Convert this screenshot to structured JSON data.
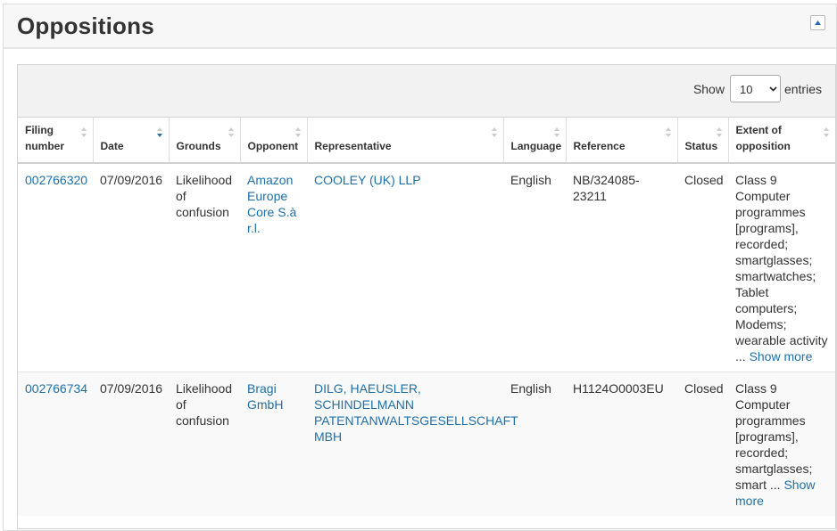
{
  "panel": {
    "title": "Oppositions"
  },
  "length": {
    "prefix": "Show",
    "value": "10",
    "suffix": "entries"
  },
  "columns": [
    {
      "label": "Filing number"
    },
    {
      "label": "Date"
    },
    {
      "label": "Grounds"
    },
    {
      "label": "Opponent"
    },
    {
      "label": "Representative"
    },
    {
      "label": "Language"
    },
    {
      "label": "Reference"
    },
    {
      "label": "Status"
    },
    {
      "label": "Extent of opposition"
    }
  ],
  "rows": [
    {
      "filing_number": "002766320",
      "date": "07/09/2016",
      "grounds": "Likelihood of confusion",
      "opponent": "Amazon Europe Core S.à r.l.",
      "representative": "COOLEY (UK) LLP",
      "language": "English",
      "reference": "NB/324085-23211",
      "status": "Closed",
      "extent": "Class 9 Computer programmes [programs], recorded; smartglasses; smartwatches; Tablet computers; Modems; wearable activity",
      "ellipsis": " ... ",
      "show_more": "Show more"
    },
    {
      "filing_number": "002766734",
      "date": "07/09/2016",
      "grounds": "Likelihood of confusion",
      "opponent": "Bragi GmbH",
      "representative": "DILG, HAEUSLER, SCHINDELMANN PATENTANWALTSGESELLSCHAFT MBH",
      "language": "English",
      "reference": "H1124O0003EU",
      "status": "Closed",
      "extent": "Class 9 Computer programmes [programs], recorded; smartglasses; smart",
      "ellipsis": " ... ",
      "show_more": "Show more"
    }
  ],
  "colors": {
    "link": "#1f6fa8",
    "header_bg": "#f7f7f7",
    "toolbar_bg": "#f2f2f2"
  },
  "icons": {
    "collapse": "caret-up-icon",
    "sort": "sort-both-icon",
    "sort_active": "sort-desc-icon",
    "select": "chevron-down-icon"
  }
}
